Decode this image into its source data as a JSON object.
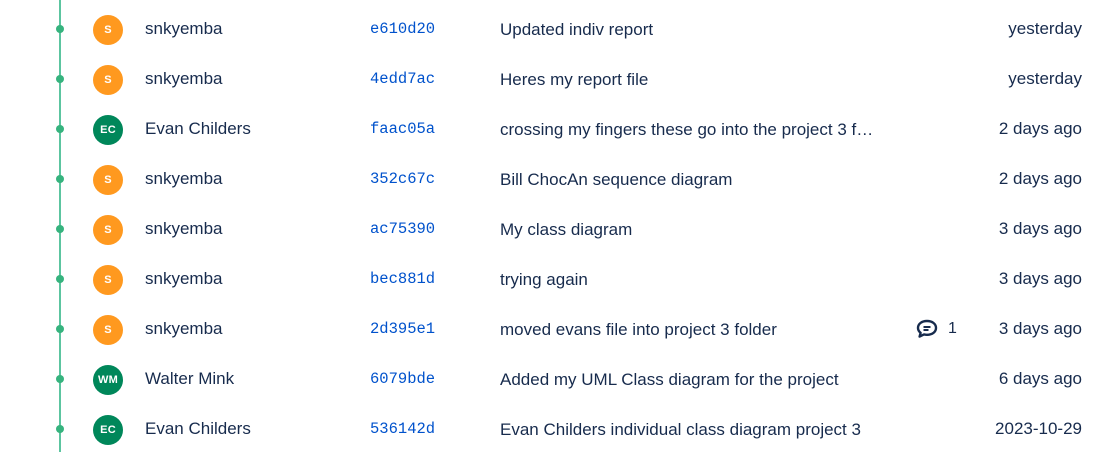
{
  "colors": {
    "graph_line": "#5cc5a0",
    "avatar_s": "#ff991f",
    "avatar_ec": "#00875a",
    "avatar_wm": "#00875a",
    "hash_link": "#0052cc"
  },
  "commits": [
    {
      "initials": "S",
      "author": "snkyemba",
      "hash": "e610d20",
      "message": "Updated indiv report",
      "comments": "",
      "date": "yesterday",
      "avatar_color": "#ff991f"
    },
    {
      "initials": "S",
      "author": "snkyemba",
      "hash": "4edd7ac",
      "message": "Heres my report file",
      "comments": "",
      "date": "yesterday",
      "avatar_color": "#ff991f"
    },
    {
      "initials": "EC",
      "author": "Evan Childers",
      "hash": "faac05a",
      "message": "crossing my fingers these go into the project 3 f…",
      "comments": "",
      "date": "2 days ago",
      "avatar_color": "#00875a"
    },
    {
      "initials": "S",
      "author": "snkyemba",
      "hash": "352c67c",
      "message": "Bill ChocAn sequence diagram",
      "comments": "",
      "date": "2 days ago",
      "avatar_color": "#ff991f"
    },
    {
      "initials": "S",
      "author": "snkyemba",
      "hash": "ac75390",
      "message": "My class diagram",
      "comments": "",
      "date": "3 days ago",
      "avatar_color": "#ff991f"
    },
    {
      "initials": "S",
      "author": "snkyemba",
      "hash": "bec881d",
      "message": "trying again",
      "comments": "",
      "date": "3 days ago",
      "avatar_color": "#ff991f"
    },
    {
      "initials": "S",
      "author": "snkyemba",
      "hash": "2d395e1",
      "message": "moved evans file into project 3 folder",
      "comments": "1",
      "date": "3 days ago",
      "avatar_color": "#ff991f"
    },
    {
      "initials": "WM",
      "author": "Walter Mink",
      "hash": "6079bde",
      "message": "Added my UML Class diagram for the project",
      "comments": "",
      "date": "6 days ago",
      "avatar_color": "#00875a"
    },
    {
      "initials": "EC",
      "author": "Evan Childers",
      "hash": "536142d",
      "message": "Evan Childers individual class diagram project 3",
      "comments": "",
      "date": "2023-10-29",
      "avatar_color": "#00875a"
    }
  ]
}
